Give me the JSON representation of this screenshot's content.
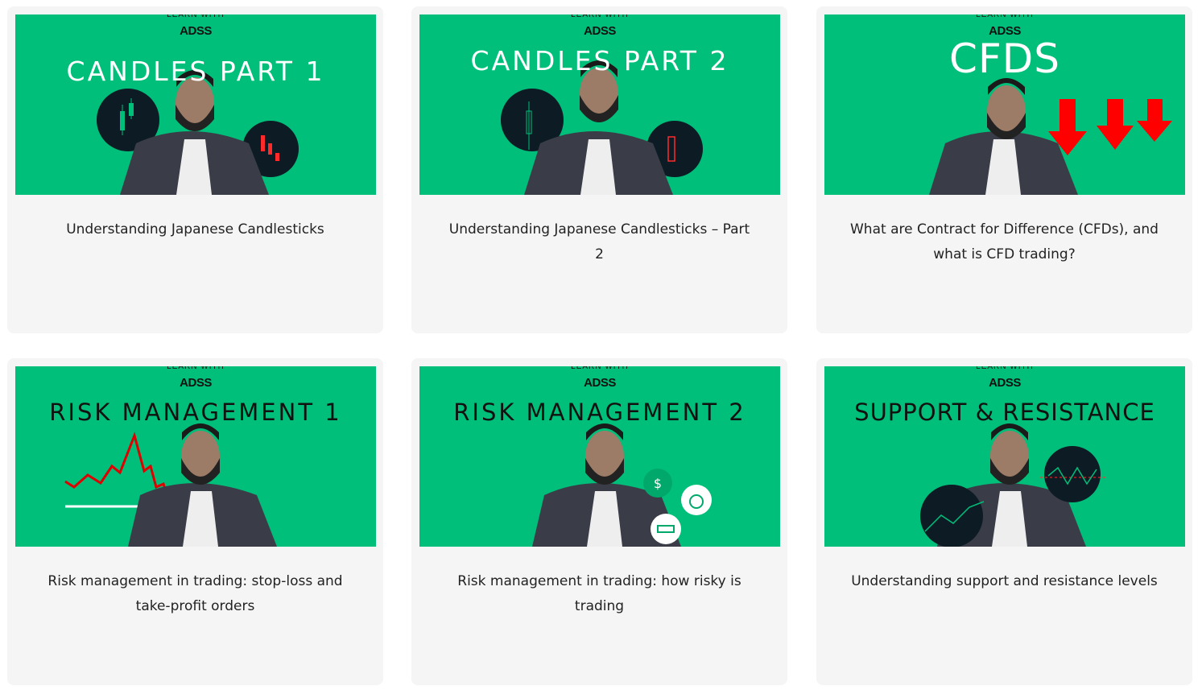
{
  "brand": {
    "tagline": "LEARN WITH",
    "logo": "ADSS"
  },
  "colors": {
    "thumbnail_bg": "#00bf7a",
    "card_bg": "#f5f5f5",
    "accent_red": "#ff0000"
  },
  "cards": [
    {
      "thumb_title": "CANDLES PART 1",
      "caption": "Understanding Japanese Candlesticks"
    },
    {
      "thumb_title": "CANDLES PART 2",
      "caption": "Understanding Japanese Candlesticks – Part 2"
    },
    {
      "thumb_title": "CFDS",
      "caption": "What are Contract for Difference (CFDs), and what is CFD trading?"
    },
    {
      "thumb_title": "RISK MANAGEMENT 1",
      "caption": "Risk management in trading: stop-loss and take-profit orders"
    },
    {
      "thumb_title": "RISK MANAGEMENT 2",
      "caption": "Risk management in trading: how risky is trading"
    },
    {
      "thumb_title": "SUPPORT & RESISTANCE",
      "caption": "Understanding support and resistance levels"
    }
  ]
}
